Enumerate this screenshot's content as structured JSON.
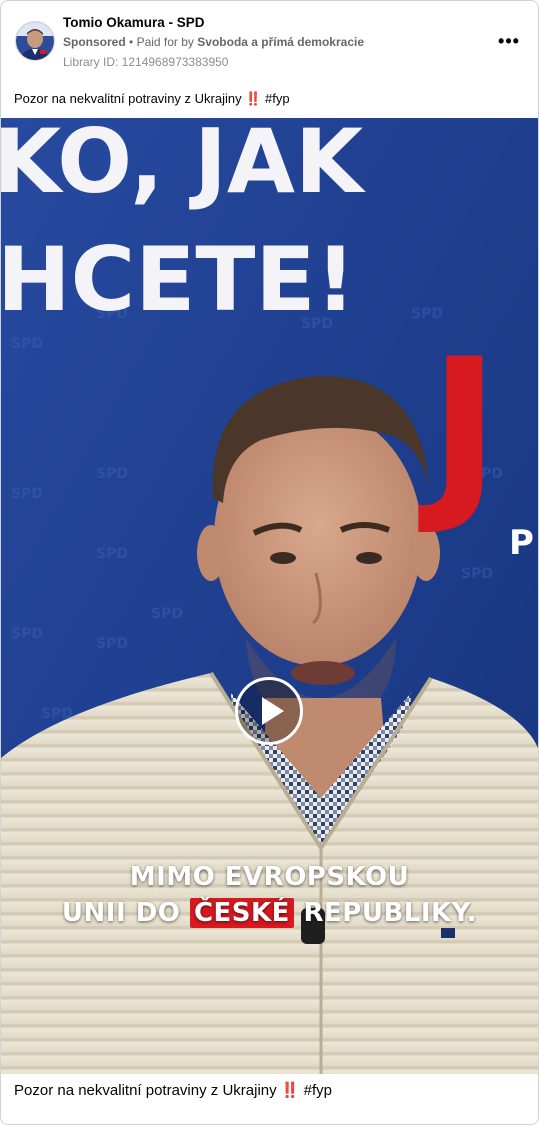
{
  "header": {
    "page_name": "Tomio Okamura - SPD",
    "sponsored_label": "Sponsored",
    "paid_for_prefix": "Paid for by",
    "paid_for_by": "Svoboda a přímá demokracie",
    "library_id": "Library ID: 1214968973383950",
    "more_icon": "more-horizontal-icon"
  },
  "post": {
    "caption_text": "Pozor na nekvalitní potraviny z Ukrajiny",
    "caption_emoji": "‼️",
    "caption_tag": "#fyp"
  },
  "video": {
    "backdrop_line1": "KO, JAK",
    "backdrop_line2": "HCETE!",
    "backdrop_letter": "J",
    "backdrop_small": "P",
    "subtitle_line1": "MIMO EVROPSKOU",
    "subtitle_line2_a": "UNII DO",
    "subtitle_line2_highlight": "ČESKÉ",
    "subtitle_line2_b": "REPUBLIKY.",
    "play_icon": "play-icon",
    "colors": {
      "backdrop": "#1f3f8e",
      "accent_red": "#d71920",
      "sweater": "#e8e2d2"
    }
  },
  "footer": {
    "caption_text": "Pozor na nekvalitní potraviny z Ukrajiny",
    "caption_emoji": "‼️",
    "caption_tag": "#fyp"
  }
}
